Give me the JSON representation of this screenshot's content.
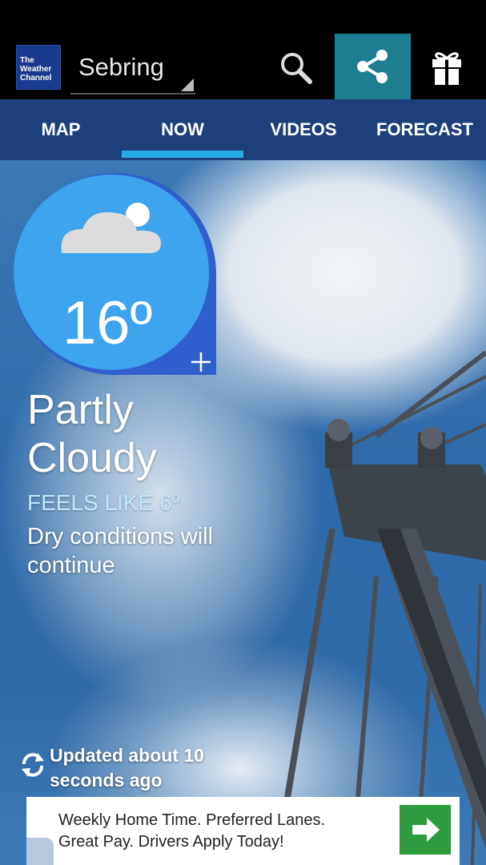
{
  "app": {
    "logo_text": "The Weather Channel",
    "location": "Sebring"
  },
  "tabs": [
    {
      "label": "MAP"
    },
    {
      "label": "NOW"
    },
    {
      "label": "VIDEOS"
    },
    {
      "label": "FORECAST"
    }
  ],
  "active_tab": "NOW",
  "current": {
    "temperature": "16º",
    "condition": "Partly Cloudy",
    "feels_like": "FEELS LIKE 6º",
    "description": "Dry conditions will continue",
    "updated": "Updated about 10 seconds ago"
  },
  "ad": {
    "text": "Weekly Home Time. Preferred Lanes. Great Pay. Drivers Apply Today!",
    "cta_icon": "arrow-right-icon"
  },
  "icons": {
    "search": "search-icon",
    "share": "share-icon",
    "gift": "gift-icon",
    "weather": "partly-cloudy-icon",
    "refresh": "refresh-icon",
    "add": "plus-icon"
  },
  "colors": {
    "tab_bar": "#1d3f7b",
    "tab_indicator": "#29a9e6",
    "share_button": "#1d7d91",
    "temp_badge": "#3ea4ee",
    "feels_like_text": "#bfe8ff",
    "ad_cta": "#2e9b3e"
  }
}
